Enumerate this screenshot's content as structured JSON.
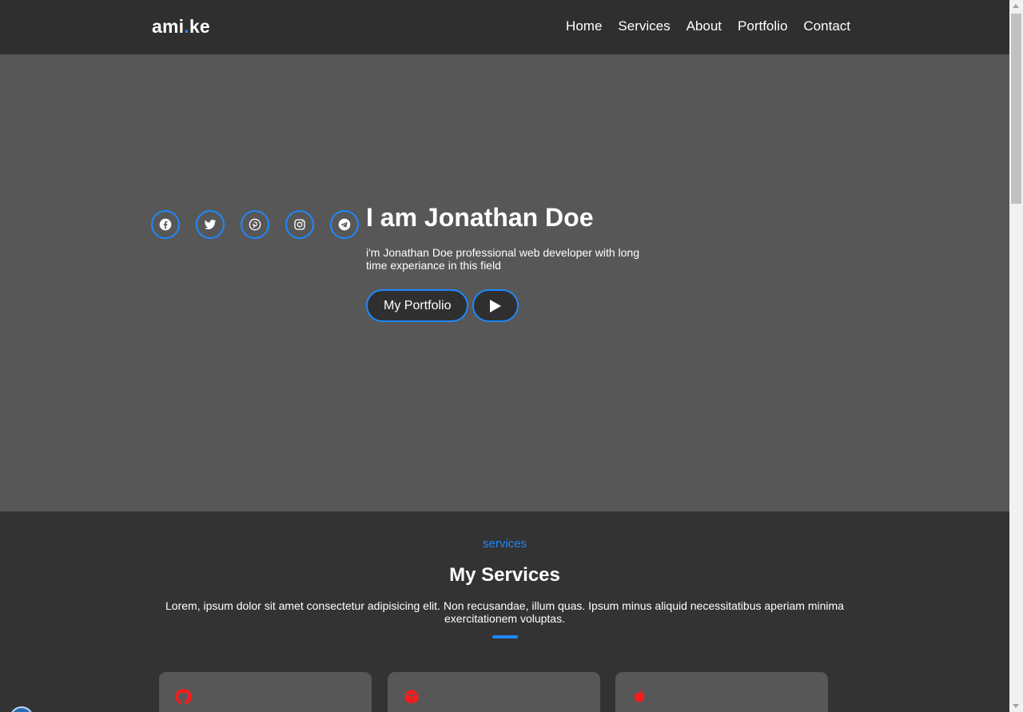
{
  "nav": {
    "logo_main": "ami",
    "logo_dot": ".",
    "logo_tail": "ke",
    "links": [
      "Home",
      "Services",
      "About",
      "Portfolio",
      "Contact"
    ]
  },
  "hero": {
    "title": "I am Jonathan Doe",
    "description": "i'm Jonathan Doe professional web developer with long time experiance in this field",
    "portfolio_button": "My Portfolio",
    "socials": [
      "facebook-icon",
      "twitter-icon",
      "pinterest-icon",
      "instagram-icon",
      "telegram-icon"
    ]
  },
  "services": {
    "kicker": "services",
    "title": "My Services",
    "description": "Lorem, ipsum dolor sit amet consectetur adipisicing elit. Non recusandae, illum quas. Ipsum minus aliquid necessitatibus aperiam minima exercitationem voluptas.",
    "cards": [
      {
        "icon": "github-icon"
      },
      {
        "icon": "cube-icon"
      },
      {
        "icon": "apple-icon"
      }
    ]
  },
  "colors": {
    "accent": "#1e88ff",
    "icon_red": "#ff1a1a",
    "nav_bg": "#2f2f2f",
    "hero_bg": "#575757",
    "section_bg": "#333333"
  }
}
